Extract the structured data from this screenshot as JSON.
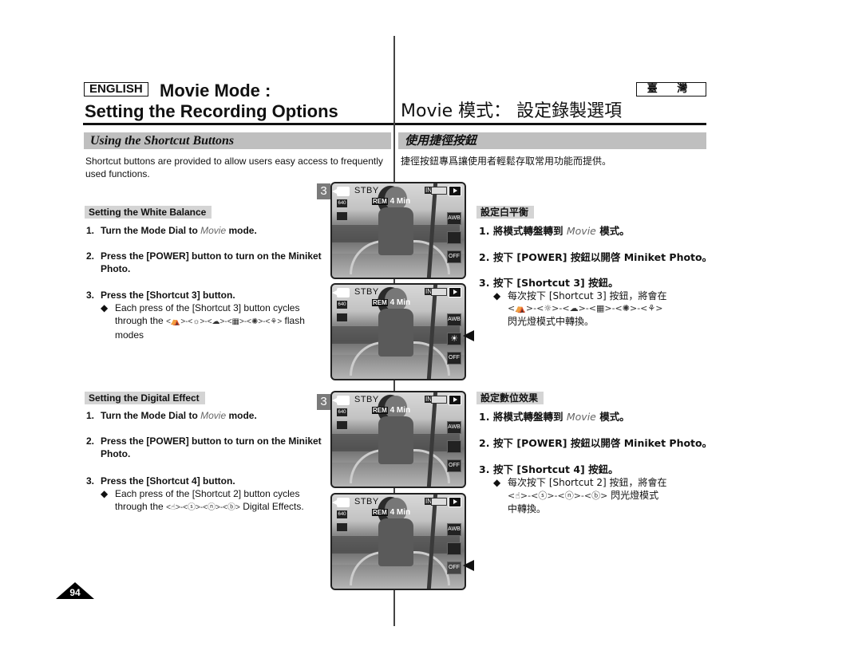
{
  "header": {
    "language_label": "ENGLISH",
    "title_line1": "Movie Mode :",
    "title_line2": "Setting the Recording Options",
    "region_label": "臺 灣",
    "zh_title": "Movie  模式：  設定錄製選項"
  },
  "section": {
    "en_title": "Using the Shortcut Buttons",
    "zh_title": "使用捷徑按鈕",
    "en_intro": "Shortcut buttons are provided to allow users easy access to frequently used functions.",
    "zh_intro": "捷徑按鈕專爲讓使用者輕鬆存取常用功能而提供。"
  },
  "white_balance": {
    "en_label": "Setting the White Balance",
    "zh_label": "設定白平衡",
    "en_steps": [
      {
        "num": "1.",
        "pre": "Turn the Mode Dial to ",
        "em": "Movie",
        "post": " mode."
      },
      {
        "num": "2.",
        "text": "Press the [POWER] button to turn on the Miniket Photo."
      },
      {
        "num": "3.",
        "text": "Press the [Shortcut 3] button."
      }
    ],
    "en_bullet": {
      "symbol": "◆",
      "pre": "Each press of the [Shortcut 3] button cycles through the ",
      "cycle": "<⛺>-<☼>-<☁>-<▦>-<✺>-<⚘>",
      "post": " flash modes"
    },
    "zh_steps": [
      {
        "num": "1.",
        "pre": "將模式轉盤轉到 ",
        "em": "Movie",
        "post": " 模式。"
      },
      {
        "num": "2.",
        "text": "按下 [POWER] 按鈕以開啓 Miniket Photo。"
      },
      {
        "num": "3.",
        "text": "按下 [Shortcut 3] 按鈕。"
      }
    ],
    "zh_bullet": {
      "symbol": "◆",
      "line1": "每次按下 [Shortcut 3] 按鈕，將會在",
      "cycle": "<⛺>-<☼>-<☁>-<▦>-<✺>-<⚘>",
      "line3": "閃光燈模式中轉換。"
    }
  },
  "digital_effect": {
    "en_label": "Setting the Digital Effect",
    "zh_label": "設定數位效果",
    "en_steps": [
      {
        "num": "1.",
        "pre": "Turn the Mode Dial to ",
        "em": "Movie",
        "post": " mode."
      },
      {
        "num": "2.",
        "text": "Press the [POWER] button to turn on the Miniket Photo."
      },
      {
        "num": "3.",
        "text": "Press the [Shortcut 4] button."
      }
    ],
    "en_bullet": {
      "symbol": "◆",
      "pre": "Each press of the [Shortcut 2] button cycles through the ",
      "cycle": "<☝>-<ⓢ>-<ⓝ>-<ⓑ>",
      "post": " Digital Effects."
    },
    "zh_steps": [
      {
        "num": "1.",
        "pre": "將模式轉盤轉到 ",
        "em": "Movie",
        "post": " 模式。"
      },
      {
        "num": "2.",
        "text": "按下 [POWER] 按鈕以開啓 Miniket Photo。"
      },
      {
        "num": "3.",
        "text": "按下 [Shortcut 4] 按鈕。"
      }
    ],
    "zh_bullet": {
      "symbol": "◆",
      "line1": "每次按下 [Shortcut 2] 按鈕，將會在",
      "cycle": "<☝>-<ⓢ>-<ⓝ>-<ⓑ>",
      "line2_post": " 閃光燈模式",
      "line3": "中轉換。"
    }
  },
  "lcd": {
    "badge": "3",
    "status": "STBY",
    "rem_label": "REM",
    "remaining": "4 Min",
    "resolution": "640",
    "memory": "IN",
    "wb_icon": "AWB",
    "highlight_wb": "☀",
    "effect_icon": "OFF"
  },
  "footer": {
    "page_number": "94"
  }
}
